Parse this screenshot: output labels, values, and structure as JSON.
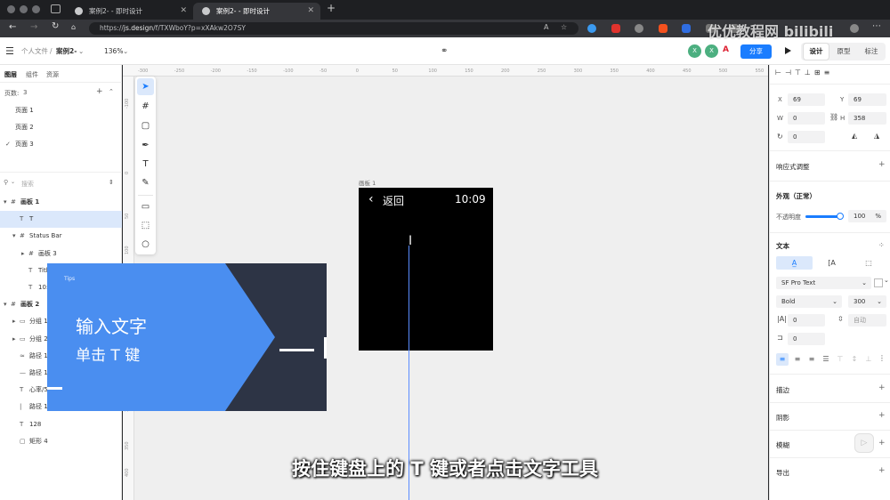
{
  "browser": {
    "tabs": [
      {
        "title": "案例2- - 即时设计",
        "active": false
      },
      {
        "title": "案例2- - 即时设计",
        "active": true
      }
    ],
    "new_tab": "+",
    "url_prefix": "https://",
    "url_domain": "js.design",
    "url_path": "/f/TXWboY?p=xXAkw2O7SY"
  },
  "app": {
    "breadcrumb_parent": "个人文件",
    "breadcrumb_sep": "/",
    "file_name": "案例2-",
    "zoom": "136%",
    "avatars": [
      "X",
      "X"
    ],
    "share_label": "分享",
    "mode_tabs": [
      "设计",
      "原型",
      "标注"
    ],
    "play_icon": "play-icon"
  },
  "left_panel": {
    "tabs": [
      "图层",
      "组件",
      "资源"
    ],
    "pages_label": "页数:",
    "pages_count": "3",
    "pages": [
      "页面 1",
      "页面 2",
      "页面 3"
    ],
    "current_page": "页面 3",
    "search_placeholder": "搜索",
    "layers": [
      {
        "name": "画板 1",
        "indent": 0,
        "type": "frame",
        "bold": true
      },
      {
        "name": "T",
        "indent": 1,
        "type": "text-edit",
        "selected": true
      },
      {
        "name": "Status Bar",
        "indent": 1,
        "type": "frame"
      },
      {
        "name": "画板 3",
        "indent": 2,
        "type": "frame"
      },
      {
        "name": "Title",
        "indent": 2,
        "type": "text"
      },
      {
        "name": "10:09",
        "indent": 2,
        "type": "text"
      },
      {
        "name": "画板 2",
        "indent": 0,
        "type": "frame",
        "bold": true
      },
      {
        "name": "分组 1",
        "indent": 1,
        "type": "group"
      },
      {
        "name": "分组 2",
        "indent": 1,
        "type": "group"
      },
      {
        "name": "路径 1",
        "indent": 1,
        "type": "path"
      },
      {
        "name": "路径 1",
        "indent": 1,
        "type": "line"
      },
      {
        "name": "心率/5",
        "indent": 1,
        "type": "text"
      },
      {
        "name": "路径 1",
        "indent": 1,
        "type": "vline"
      },
      {
        "name": "128",
        "indent": 1,
        "type": "text"
      },
      {
        "name": "矩形 4",
        "indent": 1,
        "type": "rect"
      }
    ]
  },
  "canvas": {
    "ruler_top": [
      "-300",
      "-250",
      "-200",
      "-150",
      "-100",
      "-50",
      "0",
      "50",
      "100",
      "150",
      "200",
      "250",
      "300",
      "350",
      "400",
      "450",
      "500",
      "550"
    ],
    "ruler_left": [
      "-100",
      "0",
      "50",
      "100",
      "150",
      "200",
      "250",
      "300",
      "350",
      "400"
    ],
    "artboard_label": "画板 1",
    "artboard_back": "返回",
    "artboard_time": "10:09"
  },
  "right_panel": {
    "x_label": "X",
    "x_value": "69",
    "y_label": "Y",
    "y_value": "69",
    "w_label": "W",
    "w_value": "0",
    "h_label": "H",
    "h_value": "358",
    "rotation_value": "0",
    "responsive_label": "响应式调整",
    "appearance_label": "外观（正常）",
    "opacity_label": "不透明度",
    "opacity_value": "100",
    "opacity_unit": "%",
    "opacity_fraction": 0.97,
    "text_label": "文本",
    "font_family": "SF Pro Text",
    "font_style": "Bold",
    "font_weight": "300",
    "letter_spacing": "0",
    "line_height": "自动",
    "paragraph_spacing": "0",
    "stroke_label": "描边",
    "shadow_label": "阴影",
    "blur_label": "模糊",
    "export_label": "导出"
  },
  "tips": {
    "tag": "Tips",
    "line1": "输入文字",
    "line2": "单击 T 键"
  },
  "subtitle": "按住键盘上的 T 键或者点击文字工具",
  "watermark": "优优教程网 bilibili",
  "colors": {
    "accent": "#1a7dff",
    "tips_blue": "#4a8ef0",
    "tips_dark": "#2d3445",
    "selection": "#dbe8fb",
    "avatar": "#4caf80"
  }
}
